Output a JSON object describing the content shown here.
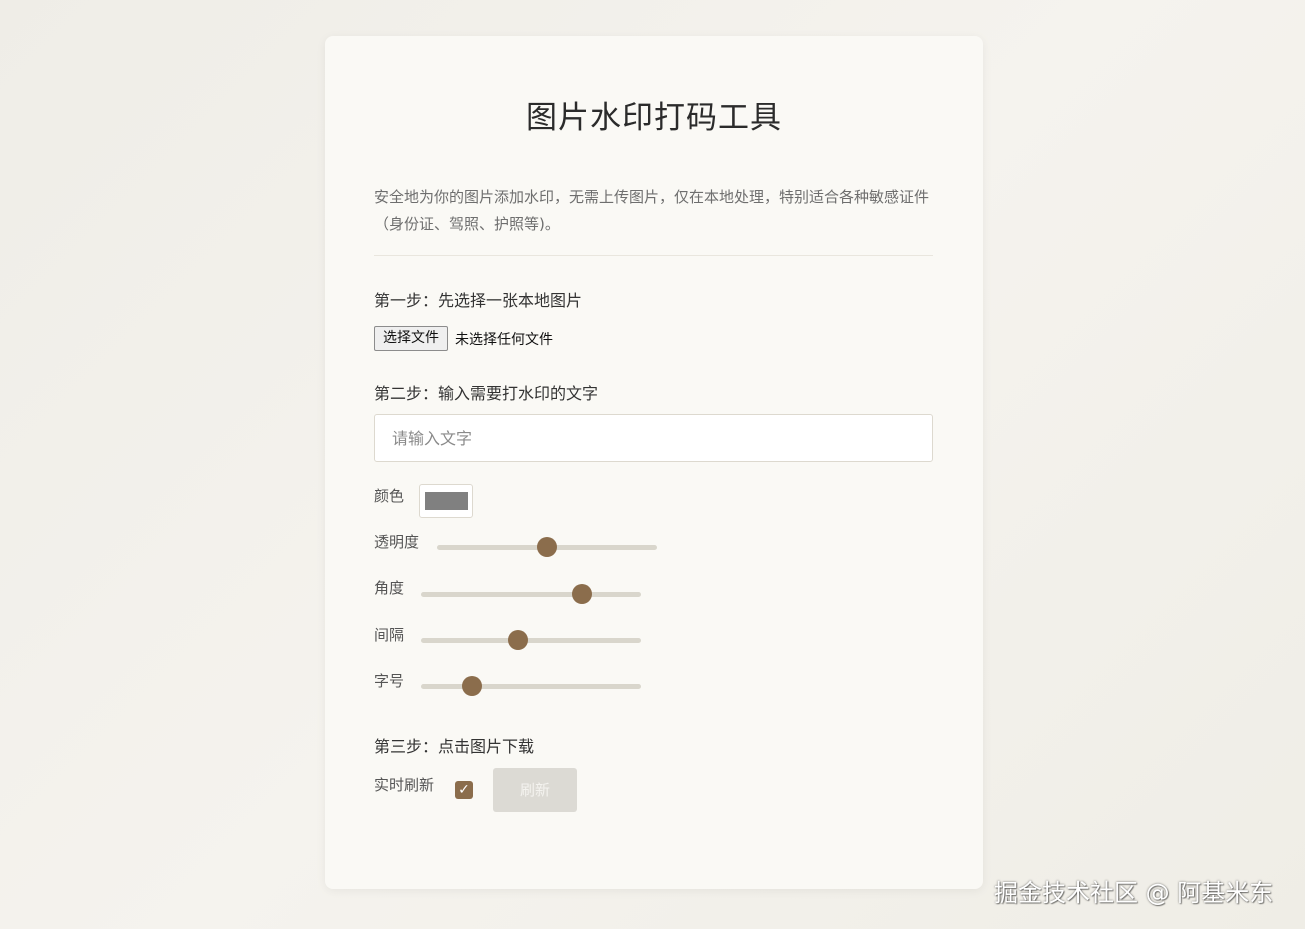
{
  "app": {
    "title": "图片水印打码工具",
    "description": "安全地为你的图片添加水印，无需上传图片，仅在本地处理，特别适合各种敏感证件（身份证、驾照、护照等)。"
  },
  "step1": {
    "label": "第一步：先选择一张本地图片",
    "file_button_label": "选择文件",
    "file_status": "未选择任何文件"
  },
  "step2": {
    "label": "第二步：输入需要打水印的文字",
    "text_input_value": "",
    "text_input_placeholder": "请输入文字",
    "color_label": "颜色",
    "color_value": "#808080",
    "opacity_label": "透明度",
    "opacity_value": 0.5,
    "angle_label": "角度",
    "angle_value": 0.73,
    "spacing_label": "间隔",
    "spacing_value": 0.44,
    "font_size_label": "字号",
    "font_size_value": 0.23
  },
  "step3": {
    "label": "第三步：点击图片下载",
    "realtime_label": "实时刷新",
    "realtime_checked": true,
    "refresh_button_label": "刷新"
  },
  "overlay": {
    "watermark_text": "掘金技术社区 @ 阿基米东"
  },
  "colors": {
    "accent": "#8b6d4c",
    "card_background": "#faf9f5",
    "page_background": "#f1efe9"
  }
}
